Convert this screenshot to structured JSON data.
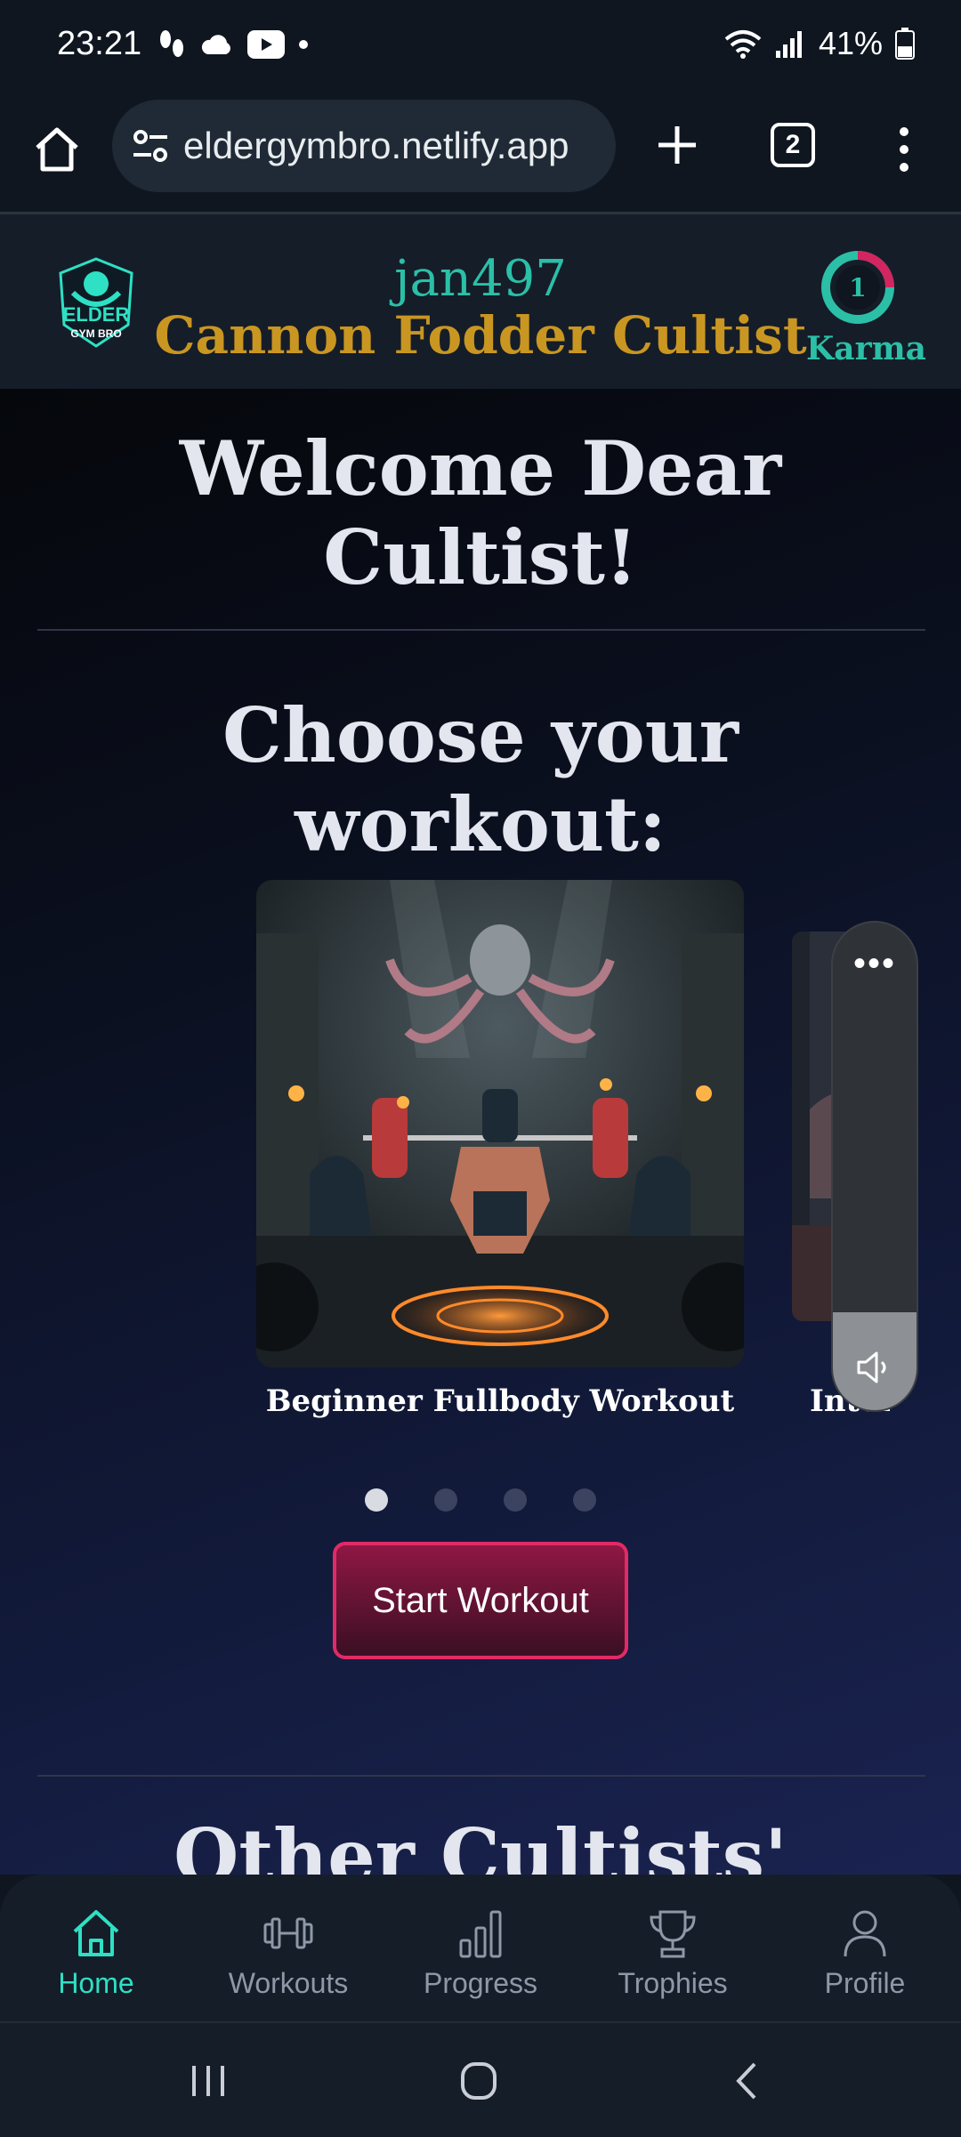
{
  "status_bar": {
    "time": "23:21",
    "battery_percent": "41%",
    "battery_level": 0.41
  },
  "browser": {
    "url": "eldergymbro.netlify.app",
    "tab_count": "2"
  },
  "header": {
    "logo_text_top": "ELDER",
    "logo_text_bottom": "GYM BRO",
    "username": "jan497",
    "rank": "Cannon Fodder Cultist",
    "karma_value": "1",
    "karma_label": "Karma",
    "colors": {
      "accent": "#2bbfa7",
      "rank": "#c99621"
    }
  },
  "main": {
    "welcome_line1": "Welcome Dear",
    "welcome_line2": "Cultist!",
    "choose_line1": "Choose your",
    "choose_line2": "workout:",
    "cards": [
      {
        "title": "Beginner Fullbody Workout"
      },
      {
        "title": "Intern"
      }
    ],
    "carousel_page": 1,
    "carousel_pages": 4,
    "start_button": "Start Workout",
    "other_heading": "Other Cultists'"
  },
  "bottom_nav": {
    "items": [
      {
        "label": "Home",
        "icon": "home-icon",
        "active": true
      },
      {
        "label": "Workouts",
        "icon": "dumbbell-icon"
      },
      {
        "label": "Progress",
        "icon": "bar-chart-icon"
      },
      {
        "label": "Trophies",
        "icon": "trophy-icon"
      },
      {
        "label": "Profile",
        "icon": "user-icon"
      }
    ]
  },
  "volume_panel": {
    "menu_icon": "more-dots-icon",
    "icon": "volume-icon"
  },
  "system_nav": {
    "recents": "recents-icon",
    "home": "home-circle-icon",
    "back": "back-icon"
  }
}
